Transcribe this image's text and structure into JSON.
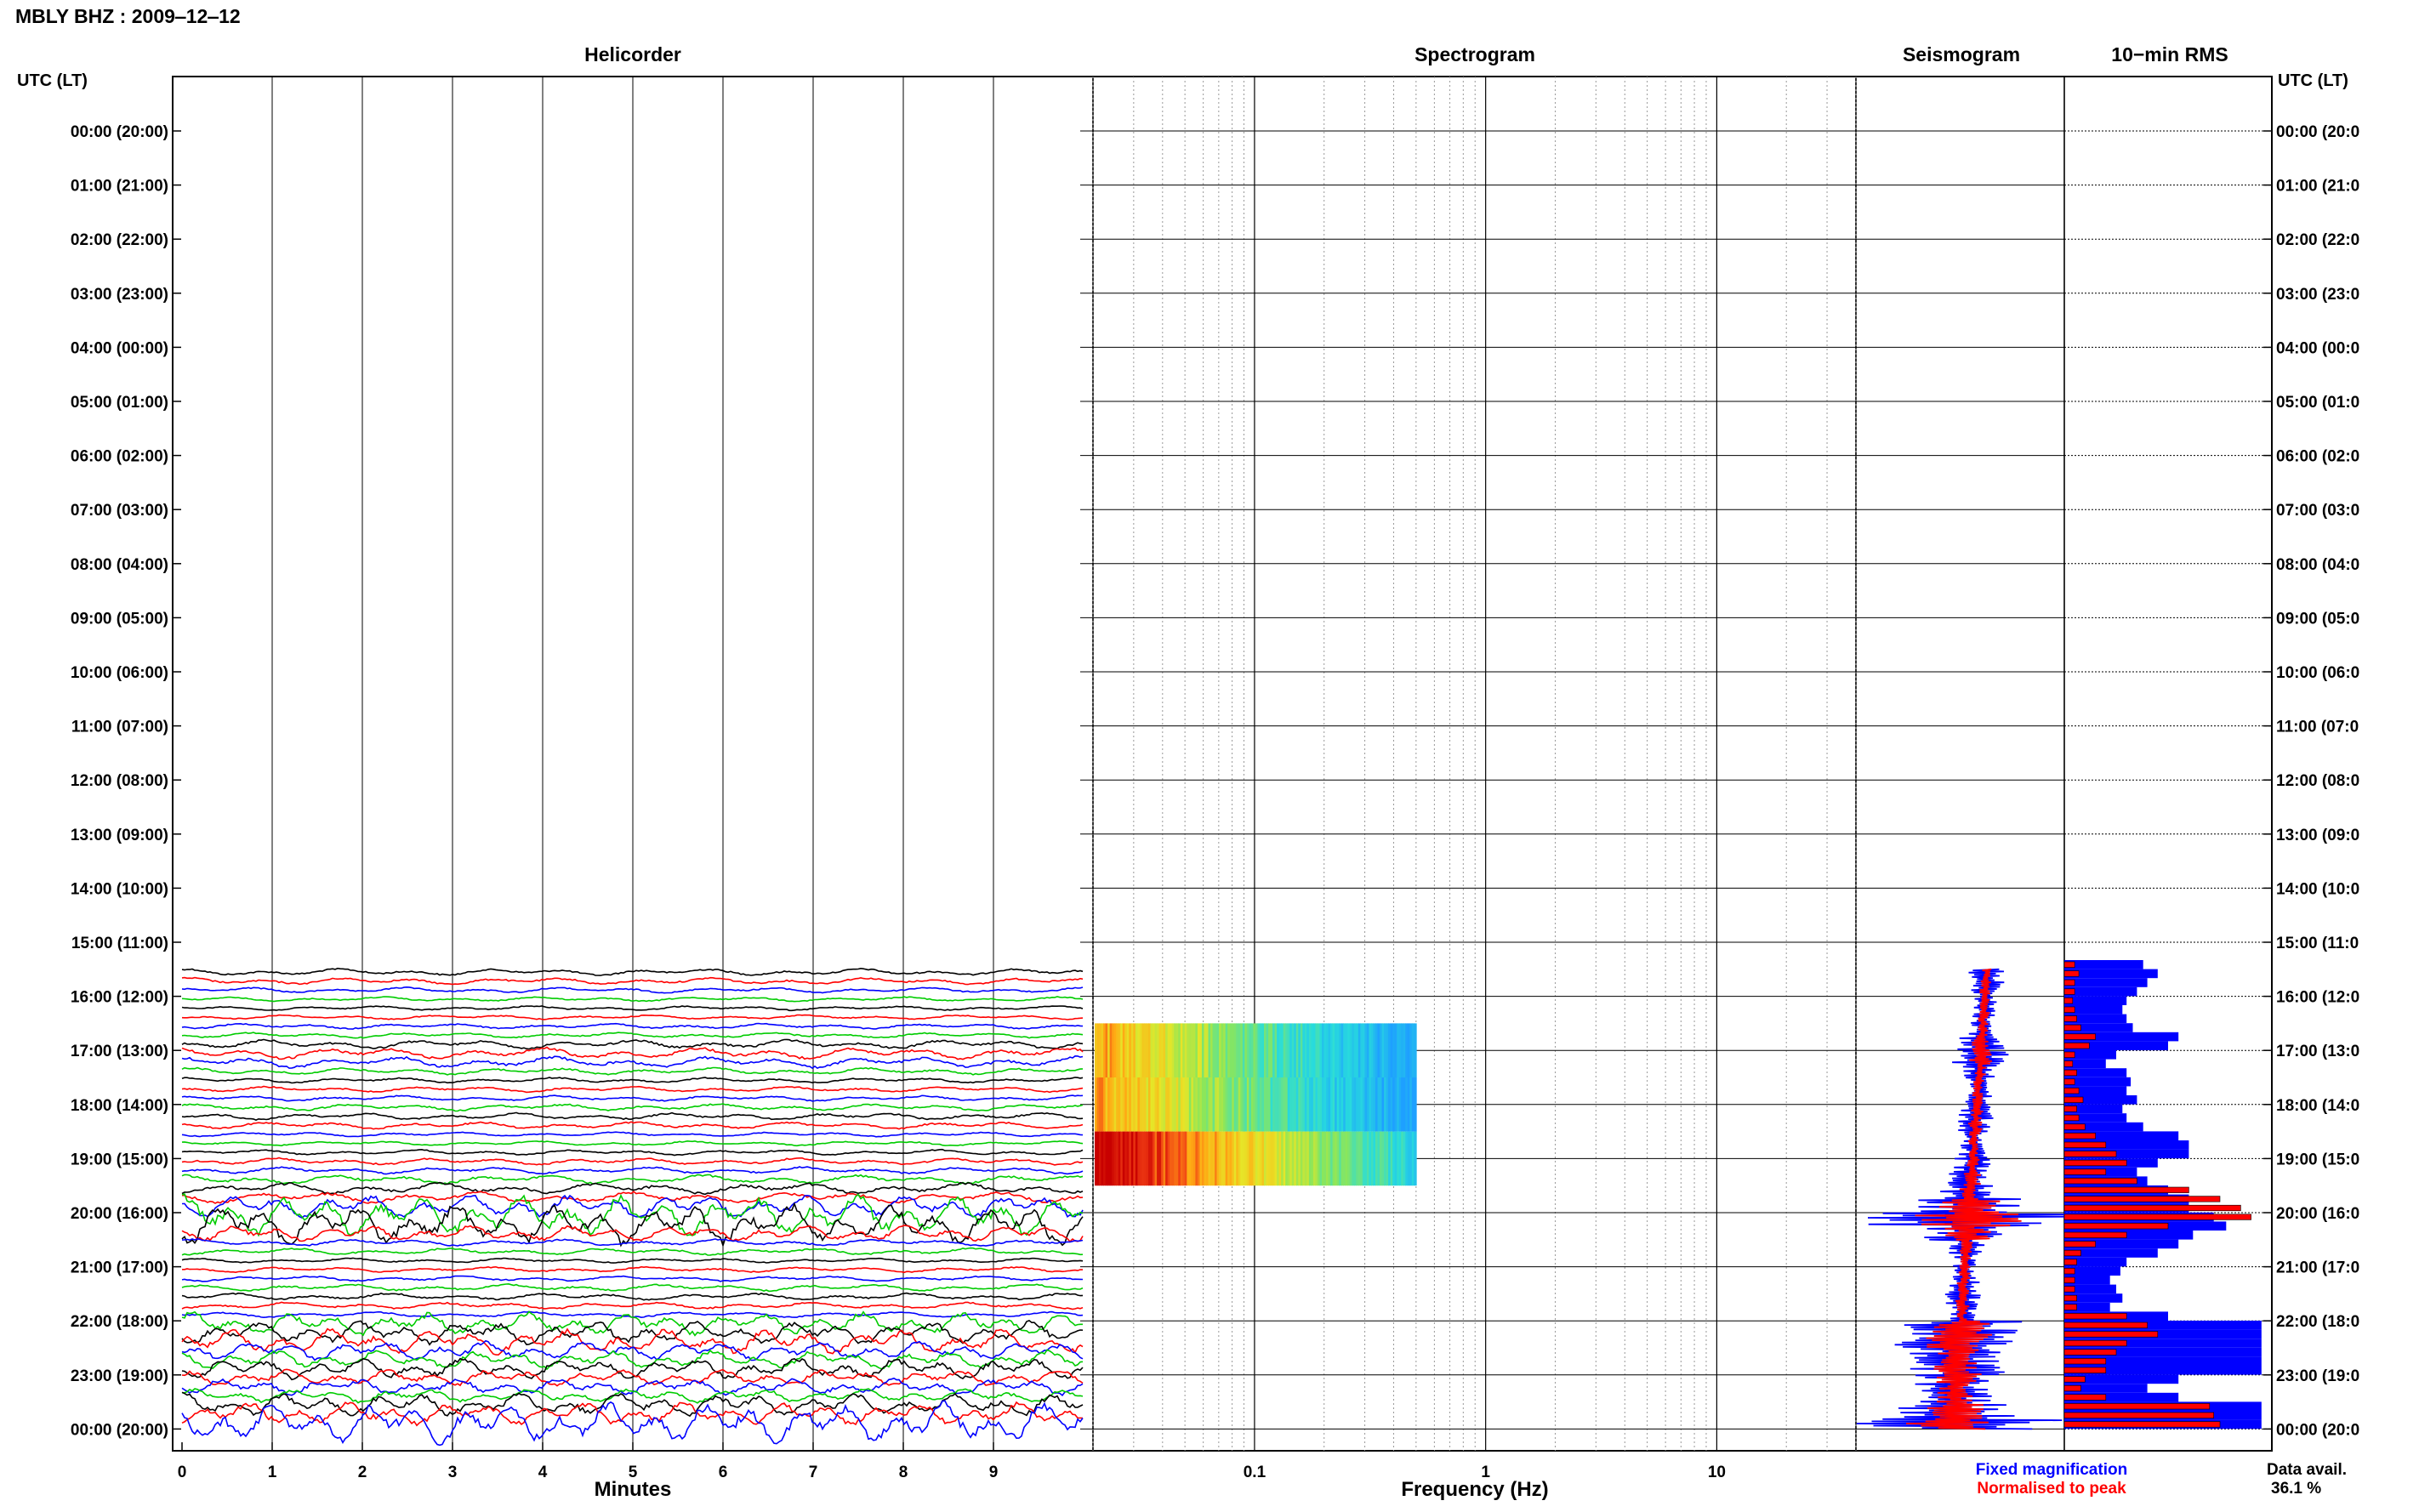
{
  "header": {
    "title": "MBLY BHZ : 2009‒12‒12"
  },
  "panels": {
    "helicorder": "Helicorder",
    "spectrogram": "Spectrogram",
    "seismogram": "Seismogram",
    "rms": "10−min RMS"
  },
  "axis_labels": {
    "left_title": "UTC (LT)",
    "right_title": "UTC (LT)",
    "minutes": "Minutes",
    "frequency": "Frequency (Hz)"
  },
  "hour_labels": [
    "00:00 (20:00)",
    "01:00 (21:00)",
    "02:00 (22:00)",
    "03:00 (23:00)",
    "04:00 (00:00)",
    "05:00 (01:00)",
    "06:00 (02:00)",
    "07:00 (03:00)",
    "08:00 (04:00)",
    "09:00 (05:00)",
    "10:00 (06:00)",
    "11:00 (07:00)",
    "12:00 (08:00)",
    "13:00 (09:00)",
    "14:00 (10:00)",
    "15:00 (11:00)",
    "16:00 (12:00)",
    "17:00 (13:00)",
    "18:00 (14:00)",
    "19:00 (15:00)",
    "20:00 (16:00)",
    "21:00 (17:00)",
    "22:00 (18:00)",
    "23:00 (19:00)",
    "00:00 (20:00)"
  ],
  "right_hour_labels": [
    "00:00 (20:0",
    "01:00 (21:0",
    "02:00 (22:0",
    "03:00 (23:0",
    "04:00 (00:0",
    "05:00 (01:0",
    "06:00 (02:0",
    "07:00 (03:0",
    "08:00 (04:0",
    "09:00 (05:0",
    "10:00 (06:0",
    "11:00 (07:0",
    "12:00 (08:0",
    "13:00 (09:0",
    "14:00 (10:0",
    "15:00 (11:0",
    "16:00 (12:0",
    "17:00 (13:0",
    "18:00 (14:0",
    "19:00 (15:0",
    "20:00 (16:0",
    "21:00 (17:0",
    "22:00 (18:0",
    "23:00 (19:0",
    "00:00 (20:0"
  ],
  "legend": {
    "fixed": "Fixed magnification",
    "normalised": "Normalised to peak",
    "data_avail_label": "Data avail.",
    "data_avail_value": "36.1 %"
  },
  "colors": {
    "trace_cycle": [
      "#000000",
      "#ff0000",
      "#0000ff",
      "#00cc00"
    ],
    "fixed": "#0000ff",
    "normalised": "#ff0000"
  },
  "chart_data": {
    "type": "line",
    "helicorder": {
      "x_ticks": [
        "0",
        "1",
        "2",
        "3",
        "4",
        "5",
        "6",
        "7",
        "8",
        "9"
      ],
      "x_range_minutes": [
        0,
        10
      ],
      "trace_rows_per_hour": 6,
      "data_start_hour": 15.5,
      "data_end_hour": 24
    },
    "spectrogram": {
      "x_scale": "log",
      "x_ticks": [
        "0.1",
        "1",
        "10"
      ],
      "x_range_hz": [
        0.02,
        40
      ],
      "blocks": [
        {
          "hours": [
            16.5,
            17.5
          ],
          "f_max_hz": 0.5,
          "level": 0.35
        },
        {
          "hours": [
            17.5,
            18.5
          ],
          "f_max_hz": 0.5,
          "level": 0.35
        },
        {
          "hours": [
            18.5,
            19.5
          ],
          "f_max_hz": 0.5,
          "level": 0.6
        }
      ]
    },
    "rms_10min": {
      "start_hour": 15.33,
      "fixed": [
        0.38,
        0.45,
        0.4,
        0.35,
        0.3,
        0.28,
        0.3,
        0.33,
        0.55,
        0.5,
        0.25,
        0.2,
        0.3,
        0.32,
        0.3,
        0.35,
        0.28,
        0.3,
        0.38,
        0.55,
        0.6,
        0.6,
        0.45,
        0.35,
        0.4,
        0.5,
        0.6,
        0.6,
        0.72,
        0.78,
        0.62,
        0.55,
        0.45,
        0.3,
        0.27,
        0.22,
        0.25,
        0.28,
        0.22,
        0.5,
        0.95,
        0.95,
        0.95,
        0.95,
        0.95,
        0.95,
        0.55,
        0.4,
        0.55,
        0.95,
        0.95,
        0.95
      ],
      "normalised": [
        0.05,
        0.07,
        0.05,
        0.05,
        0.04,
        0.05,
        0.06,
        0.08,
        0.15,
        0.12,
        0.05,
        0.04,
        0.06,
        0.05,
        0.07,
        0.09,
        0.06,
        0.07,
        0.1,
        0.15,
        0.2,
        0.25,
        0.3,
        0.2,
        0.35,
        0.6,
        0.75,
        0.85,
        0.9,
        0.5,
        0.3,
        0.15,
        0.08,
        0.06,
        0.05,
        0.05,
        0.05,
        0.06,
        0.06,
        0.3,
        0.4,
        0.45,
        0.3,
        0.25,
        0.2,
        0.2,
        0.1,
        0.08,
        0.2,
        0.7,
        0.72,
        0.75
      ]
    },
    "seismogram": {
      "start_hour": 15.5,
      "fixed_amp": [
        0.15,
        0.12,
        0.1,
        0.1,
        0.12,
        0.2,
        0.25,
        0.15,
        0.12,
        0.12,
        0.15,
        0.15,
        0.1,
        0.12,
        0.15,
        0.2,
        0.25,
        0.5,
        0.9,
        0.35,
        0.15,
        0.1,
        0.12,
        0.15,
        0.15,
        0.12,
        0.5,
        0.55,
        0.4,
        0.45,
        0.35,
        0.3,
        0.5,
        0.9,
        0.7
      ],
      "normalised_amp": [
        0.05,
        0.05,
        0.04,
        0.05,
        0.05,
        0.08,
        0.1,
        0.06,
        0.05,
        0.05,
        0.06,
        0.06,
        0.05,
        0.05,
        0.06,
        0.08,
        0.1,
        0.25,
        0.45,
        0.2,
        0.06,
        0.05,
        0.05,
        0.06,
        0.06,
        0.05,
        0.25,
        0.28,
        0.2,
        0.22,
        0.18,
        0.15,
        0.25,
        0.45,
        0.35
      ]
    }
  }
}
